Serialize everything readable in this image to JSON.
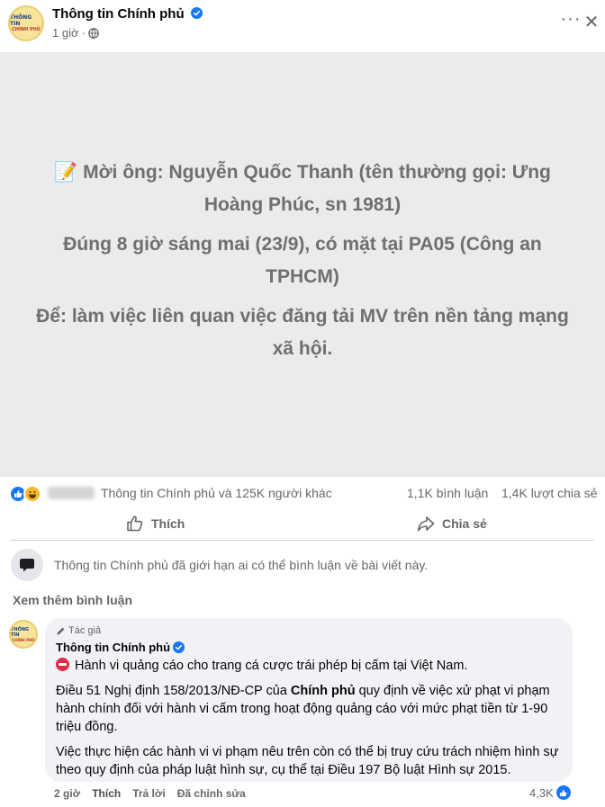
{
  "post": {
    "page_name": "Thông tin Chính phủ",
    "time": "1 giờ",
    "avatar_text_1": "THÔNG TIN",
    "avatar_text_2": "CHÍNH PHỦ",
    "image_lines": [
      "📝 Mời ông: Nguyễn Quốc Thanh (tên thường gọi: Ưng Hoàng Phúc, sn 1981)",
      "Đúng 8 giờ sáng mai (23/9), có mặt tại PA05 (Công an TPHCM)",
      "Để: làm việc liên quan việc đăng tải MV trên nền tảng mạng xã hội."
    ]
  },
  "stats": {
    "reactions_text": "Thông tin Chính phủ và 125K người khác",
    "comments": "1,1K bình luận",
    "shares": "1,4K lượt chia sẻ"
  },
  "actions": {
    "like": "Thích",
    "share": "Chia sẻ"
  },
  "limited_notice": "Thông tin Chính phủ đã giới hạn ai có thể bình luận về bài viết này.",
  "view_more_comments": "Xem thêm bình luận",
  "comment": {
    "author_tag": "Tác giả",
    "author": "Thông tin Chính phủ",
    "line1": "Hành vi quảng cáo cho trang cá cược trái phép bị cấm tại Việt Nam.",
    "p2_before": "Điều 51 Nghị định 158/2013/NĐ-CP của ",
    "p2_bold": "Chính phủ",
    "p2_after": " quy định về việc xử phạt vi phạm hành chính đối với hành vi cấm trong hoạt động quảng cáo với mức phạt tiền từ 1-90 triệu đồng.",
    "p3": "Việc thực hiện các hành vi vi phạm nêu trên còn có thể bị truy cứu trách nhiệm hình sự theo quy định của pháp luật hình sự, cụ thể tại Điều 197 Bộ luật Hình sự 2015.",
    "time": "2 giờ",
    "like": "Thích",
    "reply": "Trả lời",
    "edited": "Đã chỉnh sửa",
    "likes": "4,3K"
  },
  "colors": {
    "facebook_blue": "#1877f2",
    "image_background": "#ebebeb",
    "bubble_background": "#f0f2f5"
  }
}
